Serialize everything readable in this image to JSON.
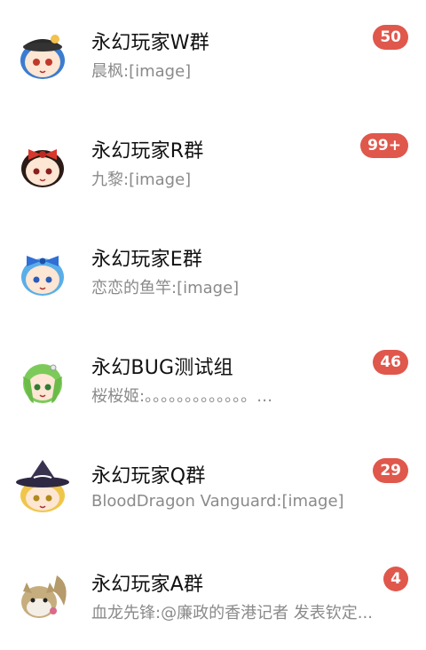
{
  "chats": [
    {
      "title": "永幻玩家W群",
      "preview": "晨枫:[image]",
      "badge": "50",
      "avatar": "blue-hair-hat-avatar-icon"
    },
    {
      "title": "永幻玩家R群",
      "preview": "九黎:[image]",
      "badge": "99+",
      "avatar": "red-bow-avatar-icon"
    },
    {
      "title": "永幻玩家E群",
      "preview": "恋恋的鱼竿:[image]",
      "badge": "",
      "avatar": "blue-bow-avatar-icon"
    },
    {
      "title": "永幻BUG测试组",
      "preview": "桜桜姬:。。。。。。。。。。。。。…",
      "badge": "46",
      "avatar": "green-hair-avatar-icon"
    },
    {
      "title": "永幻玩家Q群",
      "preview": "BloodDragon Vanguard:[image]",
      "badge": "29",
      "avatar": "witch-hat-avatar-icon"
    },
    {
      "title": "永幻玩家A群",
      "preview": "血龙先锋:@廉政的香港记者 发表钦定...",
      "badge": "4",
      "avatar": "squirrel-avatar-icon"
    }
  ],
  "colors": {
    "badge": "#e0574c",
    "title": "#111111",
    "preview": "#8a8a8a"
  }
}
